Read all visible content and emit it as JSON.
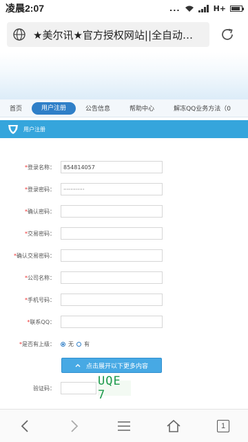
{
  "status": {
    "time": "凌晨2:07",
    "dots": "...",
    "network": "H+"
  },
  "browser": {
    "url_text": "★美尔讯★官方授权网站||全自动…",
    "icons": {
      "site": "globe-icon",
      "reload": "reload-icon"
    }
  },
  "nav": {
    "items": [
      "首页",
      "用户注册",
      "公告信息",
      "帮助中心",
      "解冻QQ业务方法（0"
    ],
    "active_index": 1
  },
  "section": {
    "title": "用户注册",
    "icon": "shield-icon"
  },
  "form": {
    "fields": [
      {
        "label": "登录名称：",
        "value": "854814057",
        "required": true
      },
      {
        "label": "登录密码：",
        "value": "············",
        "required": true
      },
      {
        "label": "确认密码：",
        "value": "",
        "required": true
      },
      {
        "label": "交易密码：",
        "value": "",
        "required": true
      },
      {
        "label": "确认交易密码：",
        "value": "",
        "required": true
      },
      {
        "label": "公司名称：",
        "value": "",
        "required": true
      },
      {
        "label": "手机号码：",
        "value": "",
        "required": true
      },
      {
        "label": "联系QQ：",
        "value": "",
        "required": true
      }
    ],
    "agent": {
      "label": "是否有上级：",
      "required": true,
      "options": [
        "无",
        "有"
      ],
      "selected": "无"
    },
    "expand_button": "点击展开以下更多内容",
    "captcha": {
      "label": "验证码：",
      "value": "",
      "image_text": "UQE 7"
    }
  },
  "bottombar": {
    "tabs": "1"
  }
}
